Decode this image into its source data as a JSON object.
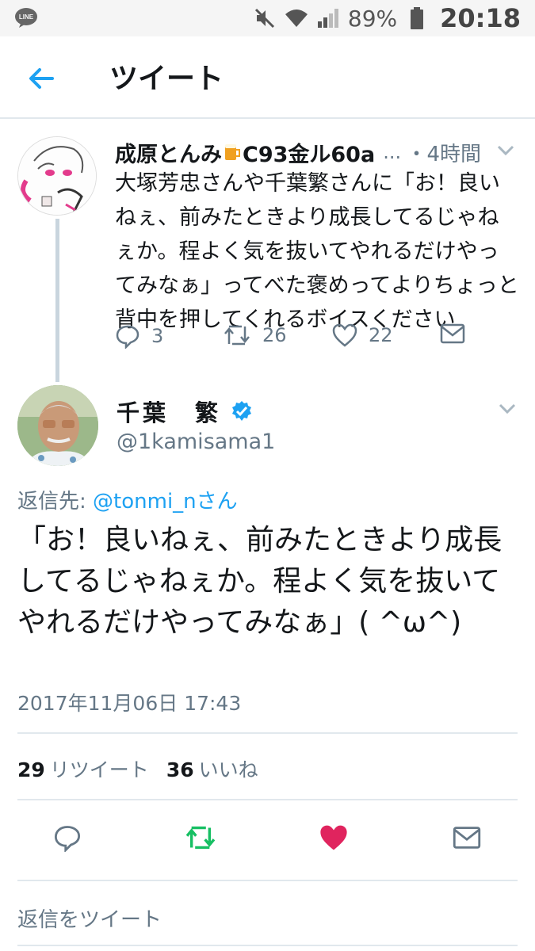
{
  "status_bar": {
    "app_icon": "line-icon",
    "app_label": "LINE",
    "battery_percent": "89%",
    "time": "20:18"
  },
  "header": {
    "title": "ツイート",
    "back_icon": "arrow-left-icon"
  },
  "parent_tweet": {
    "name_part1": "成原とんみ",
    "name_part2": "C93金ル60a",
    "ellipsis": "...",
    "time": "・4時間",
    "text": "大塚芳忠さんや千葉繁さんに「お！良いねぇ、前みたときより成長してるじゃねぇか。程よく気を抜いてやれるだけやってみなぁ」ってべた褒めってよりちょっと背中を押してくれるボイスください",
    "reply_count": "3",
    "retweet_count": "26",
    "like_count": "22"
  },
  "main_tweet": {
    "name": "千葉　繁",
    "handle": "@1kamisama1",
    "reply_prefix": "返信先: ",
    "reply_handle": "@tonmi_nさん",
    "text": "「お！良いねぇ、前みたときより成長してるじゃねぇか。程よく気を抜いてやれるだけやってみなぁ」( ^ω^)",
    "date": "2017年11月06日 17:43",
    "retweet_count": "29",
    "retweet_label": "リツイート",
    "like_count": "36",
    "like_label": "いいね"
  },
  "reply_box": {
    "placeholder": "返信をツイート"
  },
  "colors": {
    "accent": "#1da1f2",
    "retweet_green": "#17bf63",
    "like_red": "#e0245e",
    "muted": "#657786"
  }
}
